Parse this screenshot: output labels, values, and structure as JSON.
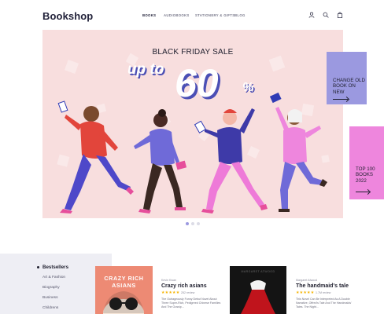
{
  "header": {
    "logo": "Bookshop",
    "nav": [
      {
        "label": "BOOKS",
        "active": true
      },
      {
        "label": "AUDIOBOOKS",
        "active": false
      },
      {
        "label": "STATIONERY & GIFTS",
        "active": false
      },
      {
        "label": "BLOG",
        "active": false
      }
    ],
    "icons": [
      "user-icon",
      "search-icon",
      "bag-icon"
    ]
  },
  "hero": {
    "title": "BLACK FRIDAY SALE",
    "discount_prefix": "up to",
    "discount_value": "60",
    "discount_suffix": "%",
    "slides": 3,
    "active_slide": 0
  },
  "side_cards": [
    {
      "text": "CHANGE OLD BOOK ON NEW",
      "color": "#9b99e0"
    },
    {
      "text": "TOP 100 BOOKS 2022",
      "color": "#ee86dd"
    }
  ],
  "sidebar": {
    "title": "Bestsellers",
    "items": [
      "Art & Fashion",
      "Biography",
      "Business",
      "Childrens"
    ]
  },
  "books": [
    {
      "cover_text": "CRAZY RICH ASIANS",
      "author": "Kevin Kwan",
      "title": "Crazy rich asians",
      "stars": "★★★★★",
      "reviews": "252 review",
      "description": "The Outrageously Funny Debut Novel About Three Super-Rich, Pedigreed Chinese Families And The Gossip..."
    },
    {
      "cover_text": "MARGARET ATWOOD",
      "author": "Margaret Atwood",
      "title": "The handmaid's tale",
      "stars": "★★★★★",
      "reviews": "1.7M review",
      "description": "This Novel Can Be Interpreted As A Double Narrative, Offred's Tale And The Handmaids' Tales. The Night..."
    }
  ],
  "colors": {
    "hero_bg": "#f8dede",
    "accent_purple": "#9b99e0",
    "accent_pink": "#ee86dd",
    "discount_fill": "#ffffff",
    "discount_shadow": "#4b4fb5"
  }
}
